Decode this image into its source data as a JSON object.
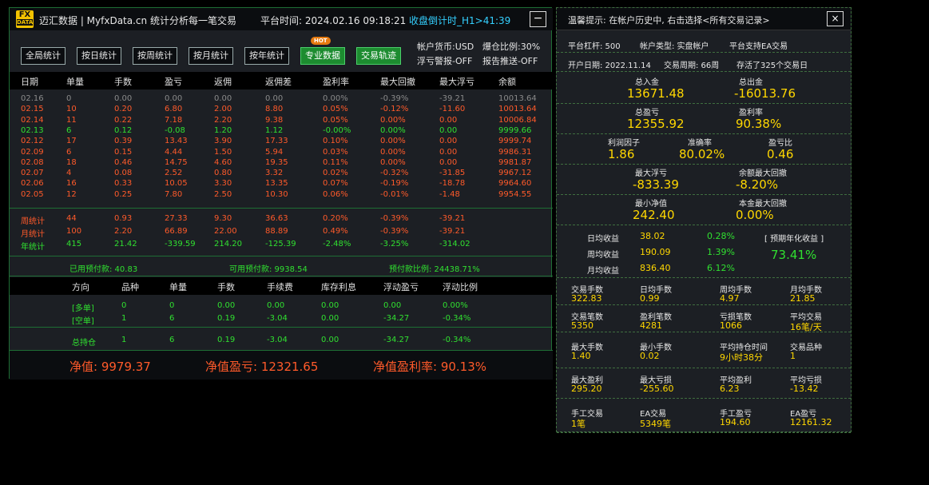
{
  "titlebar": {
    "logo_top": "FX",
    "logo_bottom": "DATA",
    "brand": "迈汇数据 | MyfxData.cn  统计分析每一笔交易",
    "time": "平台时间: 2024.02.16 09:18:21",
    "countdown": "收盘倒计时_H1>41:39",
    "minimize": "−"
  },
  "toolbar": {
    "buttons": [
      "全局统计",
      "按日统计",
      "按周统计",
      "按月统计",
      "按年统计",
      "专业数据",
      "交易轨迹"
    ],
    "hot_badge": "HOT",
    "currency": "帐户货币:USD",
    "margin_ratio": "爆仓比例:30%",
    "float_alert": "浮亏警报-OFF",
    "report_push": "报告推送-OFF"
  },
  "daily_headers": [
    "日期",
    "单量",
    "手数",
    "盈亏",
    "返佣",
    "返佣差",
    "盈利率",
    "最大回撤",
    "最大浮亏",
    "余额"
  ],
  "daily_rows": [
    {
      "c": "grey",
      "v": [
        "02.16",
        "0",
        "0.00",
        "0.00",
        "0.00",
        "0.00",
        "0.00%",
        "-0.39%",
        "-39.21",
        "10013.64"
      ]
    },
    {
      "c": "red",
      "v": [
        "02.15",
        "10",
        "0.20",
        "6.80",
        "2.00",
        "8.80",
        "0.05%",
        "-0.12%",
        "-11.60",
        "10013.64"
      ]
    },
    {
      "c": "red",
      "v": [
        "02.14",
        "11",
        "0.22",
        "7.18",
        "2.20",
        "9.38",
        "0.05%",
        "0.00%",
        "0.00",
        "10006.84"
      ]
    },
    {
      "c": "grn",
      "v": [
        "02.13",
        "6",
        "0.12",
        "-0.08",
        "1.20",
        "1.12",
        "-0.00%",
        "0.00%",
        "0.00",
        "9999.66"
      ]
    },
    {
      "c": "red",
      "v": [
        "02.12",
        "17",
        "0.39",
        "13.43",
        "3.90",
        "17.33",
        "0.10%",
        "0.00%",
        "0.00",
        "9999.74"
      ]
    },
    {
      "c": "red",
      "v": [
        "02.09",
        "6",
        "0.15",
        "4.44",
        "1.50",
        "5.94",
        "0.03%",
        "0.00%",
        "0.00",
        "9986.31"
      ]
    },
    {
      "c": "red",
      "v": [
        "02.08",
        "18",
        "0.46",
        "14.75",
        "4.60",
        "19.35",
        "0.11%",
        "0.00%",
        "0.00",
        "9981.87"
      ]
    },
    {
      "c": "red",
      "v": [
        "02.07",
        "4",
        "0.08",
        "2.52",
        "0.80",
        "3.32",
        "0.02%",
        "-0.32%",
        "-31.85",
        "9967.12"
      ]
    },
    {
      "c": "red",
      "v": [
        "02.06",
        "16",
        "0.33",
        "10.05",
        "3.30",
        "13.35",
        "0.07%",
        "-0.19%",
        "-18.78",
        "9964.60"
      ]
    },
    {
      "c": "red",
      "v": [
        "02.05",
        "12",
        "0.25",
        "7.80",
        "2.50",
        "10.30",
        "0.06%",
        "-0.01%",
        "-1.48",
        "9954.55"
      ]
    }
  ],
  "summary_rows": [
    {
      "c": "red",
      "v": [
        "周统计",
        "44",
        "0.93",
        "27.33",
        "9.30",
        "36.63",
        "0.20%",
        "-0.39%",
        "-39.21"
      ]
    },
    {
      "c": "red",
      "v": [
        "月统计",
        "100",
        "2.20",
        "66.89",
        "22.00",
        "88.89",
        "0.49%",
        "-0.39%",
        "-39.21"
      ]
    },
    {
      "c": "grn",
      "v": [
        "年统计",
        "415",
        "21.42",
        "-339.59",
        "214.20",
        "-125.39",
        "-2.48%",
        "-3.25%",
        "-314.02"
      ]
    }
  ],
  "prepay": {
    "used": "已用预付款: 40.83",
    "available": "可用预付款: 9938.54",
    "ratio": "预付款比例: 24438.71%"
  },
  "position_headers": [
    "方向",
    "品种",
    "单量",
    "手数",
    "手续费",
    "库存利息",
    "浮动盈亏",
    "浮动比例"
  ],
  "position_rows": [
    [
      "[多单]",
      "0",
      "0",
      "0.00",
      "0.00",
      "0.00",
      "0.00",
      "0.00%"
    ],
    [
      "[空单]",
      "1",
      "6",
      "0.19",
      "-3.04",
      "0.00",
      "-34.27",
      "-0.34%"
    ]
  ],
  "total_row": [
    "总持仓",
    "1",
    "6",
    "0.19",
    "-3.04",
    "0.00",
    "-34.27",
    "-0.34%"
  ],
  "bottom": {
    "net_value": "净值:  9979.37",
    "net_profit": "净值盈亏:  12321.65",
    "net_rate": "净值盈利率:  90.13%"
  },
  "right": {
    "title": "温馨提示: 在帐户历史中, 右击选择<所有交易记录>",
    "close": "×",
    "line1": [
      "平台杠杆: 500",
      "帐户类型: 实盘帐户",
      "平台支持EA交易"
    ],
    "line2": [
      "开户日期: 2022.11.14",
      "交易周期: 66周",
      "存活了325个交易日"
    ],
    "deposit_label": "总入金",
    "deposit": "13671.48",
    "withdraw_label": "总出金",
    "withdraw": "-16013.76",
    "profit_label": "总盈亏",
    "profit": "12355.92",
    "profit_rate_label": "盈利率",
    "profit_rate": "90.38%",
    "pf_label": "利润因子",
    "pf": "1.86",
    "acc_label": "准确率",
    "acc": "80.02%",
    "pl_label": "盈亏比",
    "pl": "0.46",
    "max_float_label": "最大浮亏",
    "max_float": "-833.39",
    "max_dd_label": "余额最大回撤",
    "max_dd": "-8.20%",
    "min_equity_label": "最小净值",
    "min_equity": "242.40",
    "capital_dd_label": "本金最大回撤",
    "capital_dd": "0.00%",
    "daily_gain_label": "日均收益",
    "daily_gain": "38.02",
    "daily_pct": "0.28%",
    "weekly_gain_label": "周均收益",
    "weekly_gain": "190.09",
    "weekly_pct": "1.39%",
    "monthly_gain_label": "月均收益",
    "monthly_gain": "836.40",
    "monthly_pct": "6.12%",
    "annual_label": "[ 预期年化收益 ]",
    "annual": "73.41%",
    "stats": [
      [
        [
          "交易手数",
          "322.83",
          "yel"
        ],
        [
          "日均手数",
          "0.99",
          "yel"
        ],
        [
          "周均手数",
          "4.97",
          "yel"
        ],
        [
          "月均手数",
          "21.85",
          "yel"
        ]
      ],
      [
        [
          "交易笔数",
          "5350",
          "yel"
        ],
        [
          "盈利笔数",
          "4281",
          "yel"
        ],
        [
          "亏损笔数",
          "1066",
          "yel"
        ],
        [
          "平均交易",
          "16笔/天",
          "yel"
        ]
      ],
      [
        [
          "最大手数",
          "1.40",
          "yel"
        ],
        [
          "最小手数",
          "0.02",
          "yel"
        ],
        [
          "平均持仓时间",
          "9小时38分",
          "yel"
        ],
        [
          "交易品种",
          "1",
          "yel"
        ]
      ],
      [
        [
          "最大盈利",
          "295.20",
          "yel"
        ],
        [
          "最大亏损",
          "-255.60",
          "yel"
        ],
        [
          "平均盈利",
          "6.23",
          "yel"
        ],
        [
          "平均亏损",
          "-13.42",
          "yel"
        ]
      ],
      [
        [
          "手工交易",
          "1笔",
          "yel"
        ],
        [
          "EA交易",
          "5349笔",
          "yel"
        ],
        [
          "手工盈亏",
          "194.60",
          "yel"
        ],
        [
          "EA盈亏",
          "12161.32",
          "yel"
        ]
      ]
    ]
  }
}
